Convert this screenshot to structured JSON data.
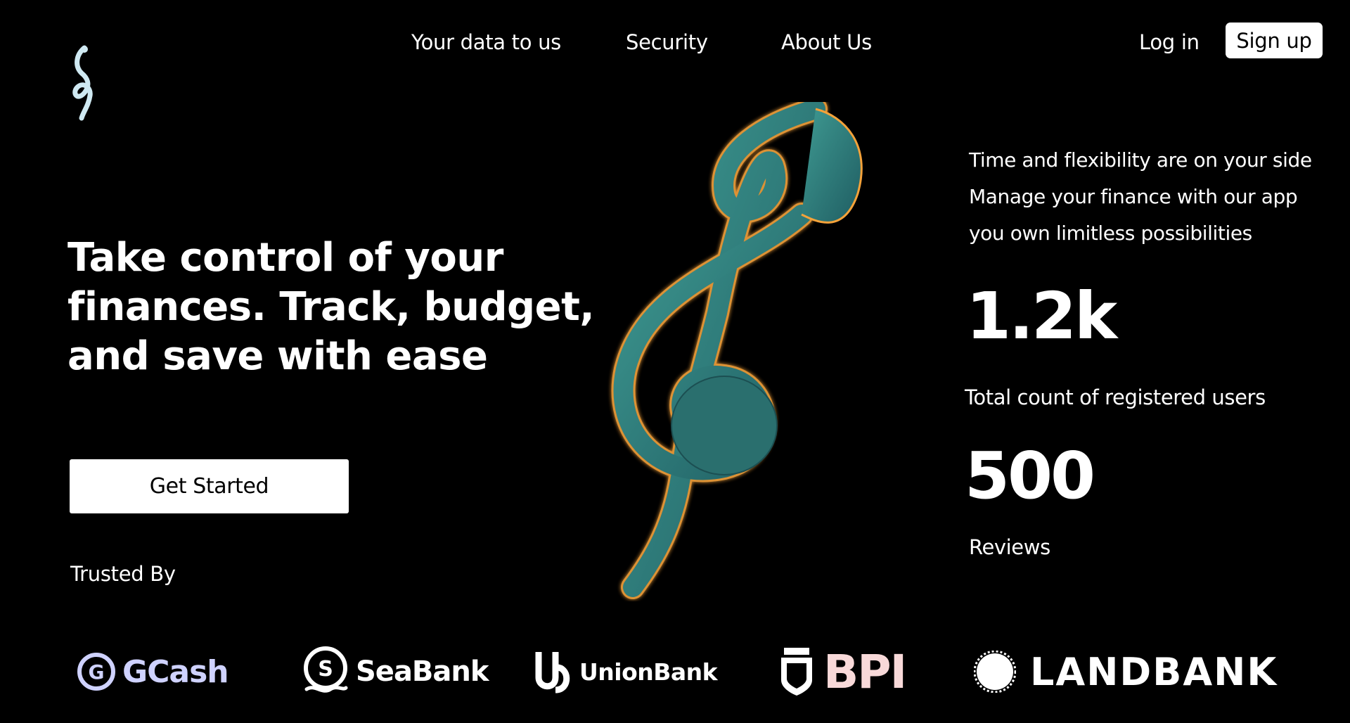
{
  "header": {
    "nav": {
      "item1": "Your data to us",
      "item2": "Security",
      "item3": "About Us"
    },
    "login_label": "Log in",
    "signup_label": "Sign up"
  },
  "hero": {
    "title": "Take control of your finances. Track, budget, and save with ease",
    "cta_label": "Get Started",
    "trusted_label": "Trusted By"
  },
  "side": {
    "tagline": {
      "line1": "Time and flexibility are on your side",
      "line2": "Manage your finance with our app",
      "line3": "you own limitless possibilities"
    },
    "stats": {
      "users_value": "1.2k",
      "users_label": "Total count of registered users",
      "reviews_value": "500",
      "reviews_label": "Reviews"
    }
  },
  "partners": {
    "gcash": "GCash",
    "seabank": "SeaBank",
    "unionbank": "UnionBank",
    "bpi": "BPI",
    "landbank": "LANDBANK"
  },
  "icons": {
    "logo": "treble-clef-logo-icon",
    "hero_art": "treble-clef-3d-icon"
  },
  "colors": {
    "background": "#000000",
    "text": "#ffffff",
    "clef_teal": "#2f7f7a",
    "clef_glow": "#f5a23a",
    "gcash": "#cfd2ff",
    "bpi": "#f8d9d9"
  }
}
